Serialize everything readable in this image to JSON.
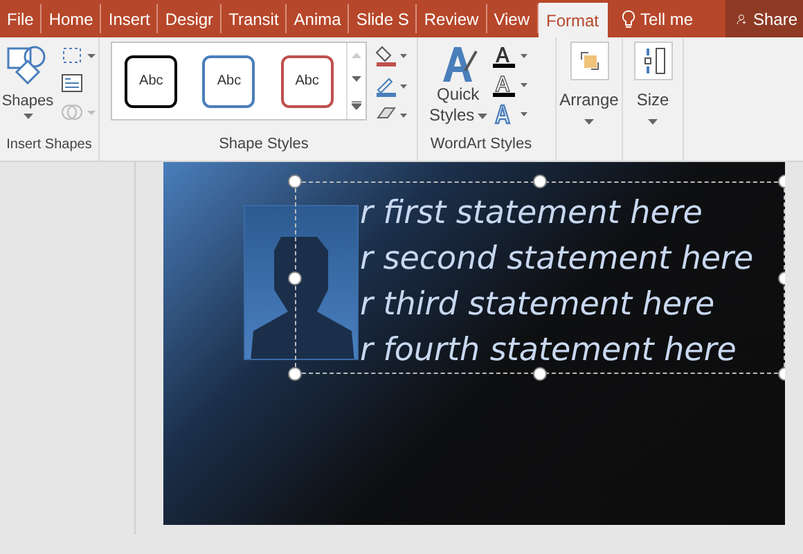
{
  "tabs": [
    {
      "label": "File",
      "selected": false
    },
    {
      "label": "Home",
      "selected": false
    },
    {
      "label": "Insert",
      "selected": false
    },
    {
      "label": "Desigr",
      "selected": false
    },
    {
      "label": "Transit",
      "selected": false
    },
    {
      "label": "Anima",
      "selected": false
    },
    {
      "label": "Slide S",
      "selected": false
    },
    {
      "label": "Review",
      "selected": false
    },
    {
      "label": "View",
      "selected": false
    },
    {
      "label": "Format",
      "selected": true
    }
  ],
  "tell_me": "Tell me",
  "share": "Share",
  "groups": {
    "insert_shapes": {
      "label": "Insert Shapes",
      "shapes_button": "Shapes"
    },
    "shape_styles": {
      "label": "Shape Styles",
      "styles": [
        {
          "label": "Abc",
          "color": "#000000"
        },
        {
          "label": "Abc",
          "color": "#4a7ebb"
        },
        {
          "label": "Abc",
          "color": "#c0504d"
        }
      ]
    },
    "wordart_styles": {
      "label": "WordArt Styles",
      "quick_styles": [
        "Quick",
        "Styles"
      ]
    },
    "arrange": {
      "label": "Arrange"
    },
    "size": {
      "label": "Size"
    }
  },
  "slide": {
    "statements": [
      "r first statement here",
      "r second statement here",
      "r third statement here",
      "r fourth statement here"
    ]
  }
}
